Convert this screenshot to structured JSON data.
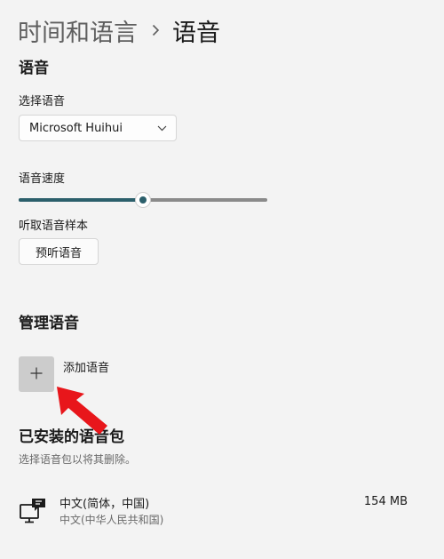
{
  "breadcrumb": {
    "parent": "时间和语言",
    "current": "语音"
  },
  "voice": {
    "section_title": "语音",
    "select_label": "选择语音",
    "selected_voice": "Microsoft Huihui",
    "speed_label": "语音速度",
    "speed_fraction": 0.5,
    "sample_label": "听取语音样本",
    "preview_button": "预听语音"
  },
  "manage": {
    "section_title": "管理语音",
    "add_label": "添加语音"
  },
  "installed": {
    "section_title": "已安装的语音包",
    "subtitle": "选择语音包以将其删除。",
    "packs": [
      {
        "name": "中文(简体，中国)",
        "sub": "中文(中华人民共和国)",
        "size": "154 MB"
      }
    ]
  },
  "colors": {
    "accent": "#2b5f6b",
    "annotation_arrow": "#e8161b",
    "background": "#f3f3f3"
  }
}
